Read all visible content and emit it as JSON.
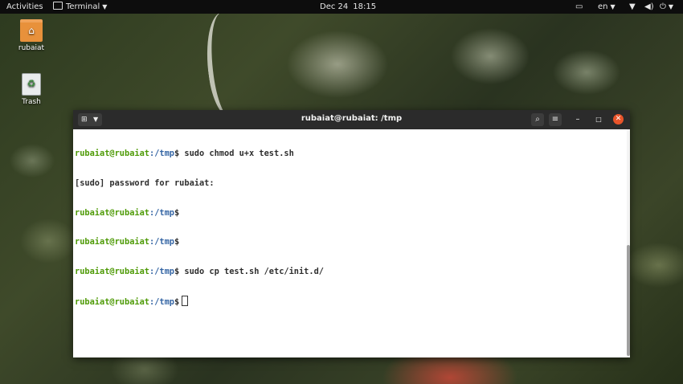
{
  "topbar": {
    "activities": "Activities",
    "app_name": "Terminal",
    "date": "Dec 24",
    "time": "18:15",
    "language": "en"
  },
  "desktop": {
    "home_label": "rubaiat",
    "trash_label": "Trash"
  },
  "window": {
    "title": "rubaiat@rubaiat: /tmp"
  },
  "terminal": {
    "lines": [
      {
        "user": "rubaiat@rubaiat",
        "path": ":/tmp",
        "sym": "$",
        "cmd": " sudo chmod u+x test.sh"
      },
      {
        "text": "[sudo] password for rubaiat:"
      },
      {
        "user": "rubaiat@rubaiat",
        "path": ":/tmp",
        "sym": "$",
        "cmd": ""
      },
      {
        "user": "rubaiat@rubaiat",
        "path": ":/tmp",
        "sym": "$",
        "cmd": ""
      },
      {
        "user": "rubaiat@rubaiat",
        "path": ":/tmp",
        "sym": "$",
        "cmd": " sudo cp test.sh /etc/init.d/"
      },
      {
        "user": "rubaiat@rubaiat",
        "path": ":/tmp",
        "sym": "$",
        "cmd": " "
      }
    ]
  },
  "colors": {
    "prompt_user": "#4e9a06",
    "prompt_path": "#3465a4",
    "close_button": "#e9542a",
    "folder": "#e8913b"
  },
  "icons": {
    "screen": "screen-icon",
    "network": "network-icon",
    "volume": "volume-icon",
    "power": "power-icon",
    "search": "search-icon",
    "menu": "hamburger-icon",
    "minimize": "minimize-icon",
    "maximize": "maximize-icon",
    "close": "close-icon"
  }
}
